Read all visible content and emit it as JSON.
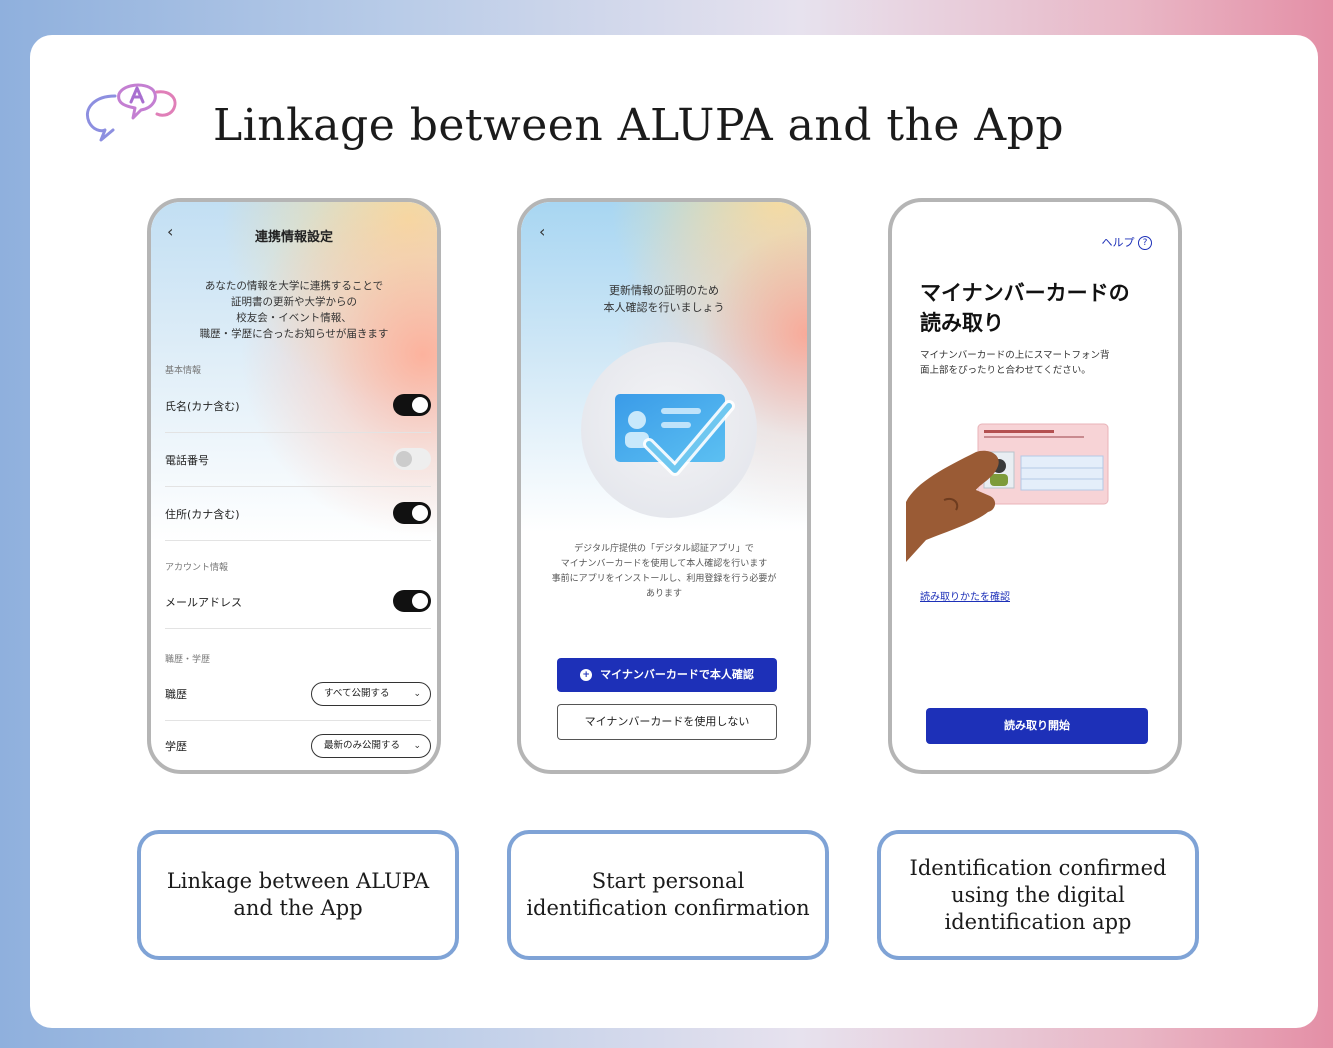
{
  "page": {
    "title": "Linkage between ALUPA and the App"
  },
  "screen1": {
    "back": "‹",
    "title": "連携情報設定",
    "intro": [
      "あなたの情報を大学に連携することで",
      "証明書の更新や大学からの",
      "校友会・イベント情報、",
      "職歴・学歴に合ったお知らせが届きます"
    ],
    "section_basic": "基本情報",
    "rows": [
      {
        "label": "氏名(カナ含む)",
        "on": true
      },
      {
        "label": "電話番号",
        "on": false
      },
      {
        "label": "住所(カナ含む)",
        "on": true
      }
    ],
    "section_account": "アカウント情報",
    "email_label": "メールアドレス",
    "section_career": "職歴・学歴",
    "job_label": "職歴",
    "job_value": "すべて公開する",
    "edu_label": "学歴",
    "edu_value": "最新のみ公開する"
  },
  "screen2": {
    "back": "‹",
    "headline": [
      "更新情報の証明のため",
      "本人確認を行いましょう"
    ],
    "body": [
      "デジタル庁提供の「デジタル認証アプリ」で",
      "マイナンバーカードを使用して本人確認を行います",
      "事前にアプリをインストールし、利用登録を行う必要が",
      "あります"
    ],
    "primary_button": "マイナンバーカードで本人確認",
    "secondary_button": "マイナンバーカードを使用しない"
  },
  "screen3": {
    "help": "ヘルプ",
    "heading": [
      "マイナンバーカードの",
      "読み取り"
    ],
    "desc": [
      "マイナンバーカードの上にスマートフォン背",
      "面上部をぴったりと合わせてください。"
    ],
    "link": "読み取りかたを確認",
    "start_button": "読み取り開始"
  },
  "captions": [
    "Linkage between ALUPA and the App",
    "Start personal identification confirmation",
    "Identification confirmed using the digital identification app"
  ],
  "colors": {
    "accent_blue": "#1d30b8",
    "caption_border": "#7fa3d6",
    "toggle_on": "#111111"
  }
}
